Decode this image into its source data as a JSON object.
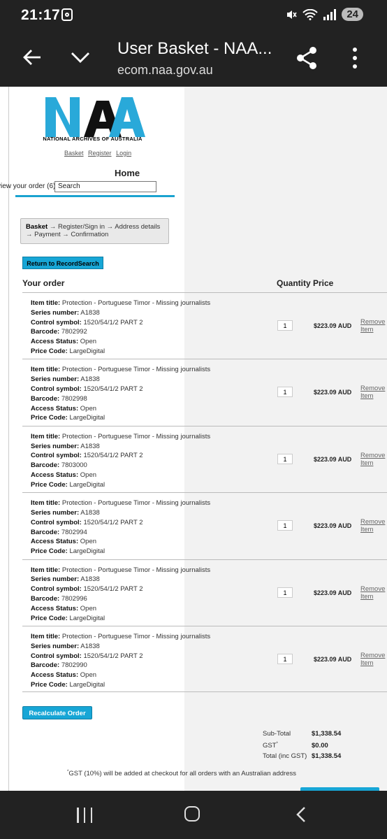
{
  "status_bar": {
    "time": "21:17",
    "battery": "24"
  },
  "browser": {
    "title": "User Basket - NAA...",
    "url": "ecom.naa.gov.au"
  },
  "site": {
    "logo_text": "NAA",
    "logo_subtitle": "NATIONAL ARCHIVES OF AUSTRALIA",
    "top_links": [
      "Basket",
      "Register",
      "Login"
    ],
    "home": "Home",
    "view_order": "view your order (6)",
    "search_value": "Search"
  },
  "steps": {
    "current": "Basket",
    "arrow": "→",
    "items": [
      "Register/Sign in",
      "Address details",
      "Payment",
      "Confirmation"
    ]
  },
  "return_button": "Return to RecordSearch",
  "table": {
    "your_order": "Your order",
    "quantity": "Quantity",
    "price": "Price"
  },
  "labels": {
    "title": "Item title:",
    "series": "Series number:",
    "control": "Control symbol:",
    "barcode": "Barcode:",
    "access": "Access Status:",
    "price_code": "Price Code:",
    "remove": "Remove Item"
  },
  "items": [
    {
      "title": "Protection - Portuguese Timor - Missing journalists",
      "series": "A1838",
      "control": "1520/54/1/2 PART 2",
      "barcode": "7802992",
      "access": "Open",
      "price_code": "LargeDigital",
      "qty": "1",
      "price": "$223.09 AUD"
    },
    {
      "title": "Protection - Portuguese Timor - Missing journalists",
      "series": "A1838",
      "control": "1520/54/1/2 PART 2",
      "barcode": "7802998",
      "access": "Open",
      "price_code": "LargeDigital",
      "qty": "1",
      "price": "$223.09 AUD"
    },
    {
      "title": "Protection - Portuguese Timor - Missing journalists",
      "series": "A1838",
      "control": "1520/54/1/2 PART 2",
      "barcode": "7803000",
      "access": "Open",
      "price_code": "LargeDigital",
      "qty": "1",
      "price": "$223.09 AUD"
    },
    {
      "title": "Protection - Portuguese Timor - Missing journalists",
      "series": "A1838",
      "control": "1520/54/1/2 PART 2",
      "barcode": "7802994",
      "access": "Open",
      "price_code": "LargeDigital",
      "qty": "1",
      "price": "$223.09 AUD"
    },
    {
      "title": "Protection - Portuguese Timor - Missing journalists",
      "series": "A1838",
      "control": "1520/54/1/2 PART 2",
      "barcode": "7802996",
      "access": "Open",
      "price_code": "LargeDigital",
      "qty": "1",
      "price": "$223.09 AUD"
    },
    {
      "title": "Protection - Portuguese Timor - Missing journalists",
      "series": "A1838",
      "control": "1520/54/1/2 PART 2",
      "barcode": "7802990",
      "access": "Open",
      "price_code": "LargeDigital",
      "qty": "1",
      "price": "$223.09 AUD"
    }
  ],
  "recalc_button": "Recalculate Order",
  "totals": {
    "subtotal_label": "Sub-Total",
    "subtotal": "$1,338.54",
    "gst_label": "GST",
    "gst": "$0.00",
    "total_label": "Total (inc GST)",
    "total": "$1,338.54",
    "note": "GST (10%) will be added at checkout for all orders with an Australian address"
  },
  "colors": {
    "accent": "#17a6d6",
    "logo_blue": "#29a9d9",
    "dark_bar": "#222222"
  }
}
